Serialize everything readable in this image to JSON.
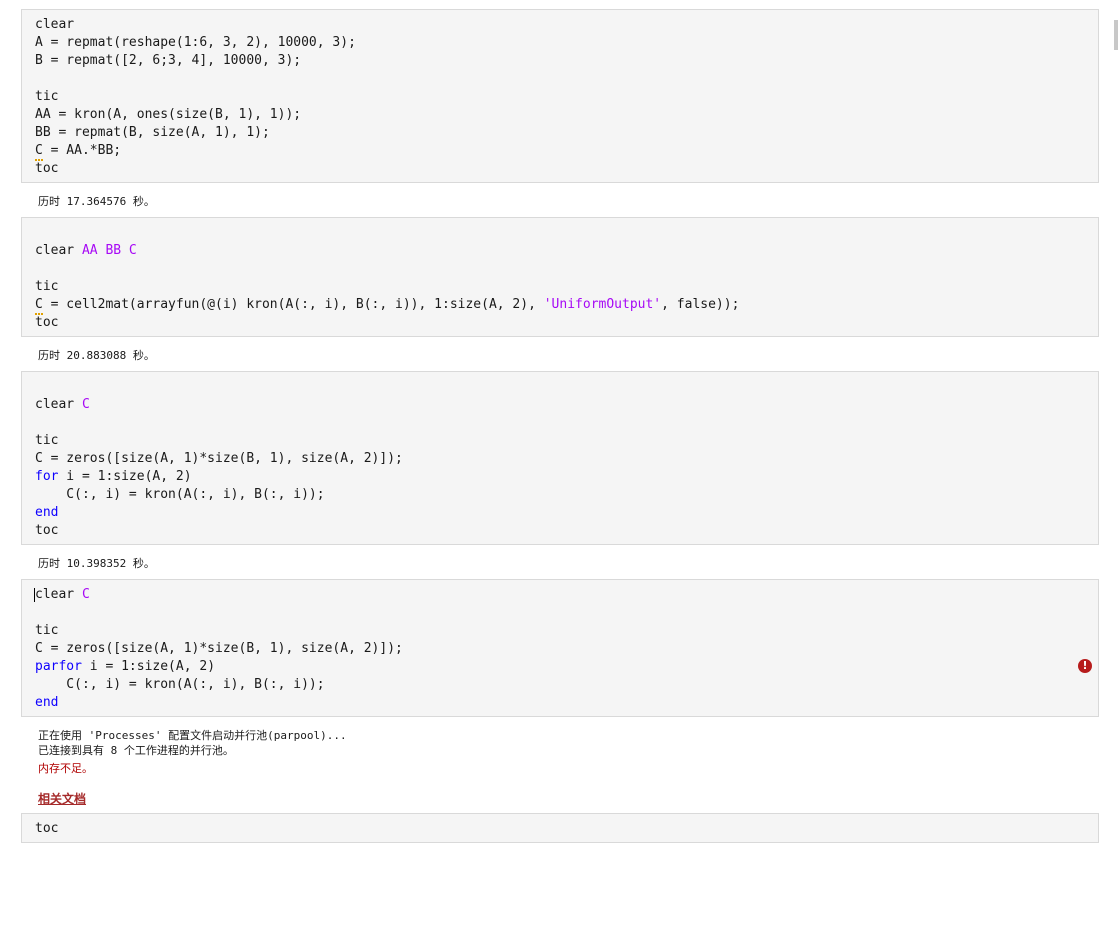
{
  "cells": [
    {
      "lines": [
        "clear",
        "A = repmat(reshape(1:6, 3, 2), 10000, 3);",
        "B = repmat([2, 6;3, 4], 10000, 3);",
        "",
        "tic",
        "AA = kron(A, ones(size(B, 1), 1));",
        "BB = repmat(B, size(A, 1), 1);",
        "C = AA.*BB;",
        "toc"
      ]
    },
    {
      "cmd": "clear",
      "cmd_args": "AA BB C",
      "lines": [
        "tic",
        "C = cell2mat(arrayfun(@(i) kron(A(:, i), B(:, i)), 1:size(A, 2), ",
        "'UniformOutput'",
        ", false));",
        "toc"
      ]
    },
    {
      "cmd": "clear",
      "cmd_args": "C",
      "lines": [
        "tic",
        "C = zeros([size(A, 1)*size(B, 1), size(A, 2)]);",
        "for",
        " i = 1:size(A, 2)",
        "    C(:, i) = kron(A(:, i), B(:, i));",
        "end",
        "toc"
      ]
    },
    {
      "cmd": "clear",
      "cmd_args": "C",
      "lines": [
        "tic",
        "C = zeros([size(A, 1)*size(B, 1), size(A, 2)]);",
        "parfor",
        " i = 1:size(A, 2)",
        "    C(:, i) = kron(A(:, i), B(:, i));",
        "end"
      ],
      "error_icon": "error-icon"
    },
    {
      "lines": [
        "toc"
      ]
    }
  ],
  "outputs": {
    "time1": "历时 17.364576 秒。",
    "time2": "历时 20.883088 秒。",
    "time3": "历时 10.398352 秒。",
    "pool_start": "正在使用 'Processes' 配置文件启动并行池(parpool)...",
    "pool_connected": "已连接到具有 8 个工作进程的并行池。",
    "out_of_memory": "内存不足。",
    "doc_link": "相关文档"
  }
}
